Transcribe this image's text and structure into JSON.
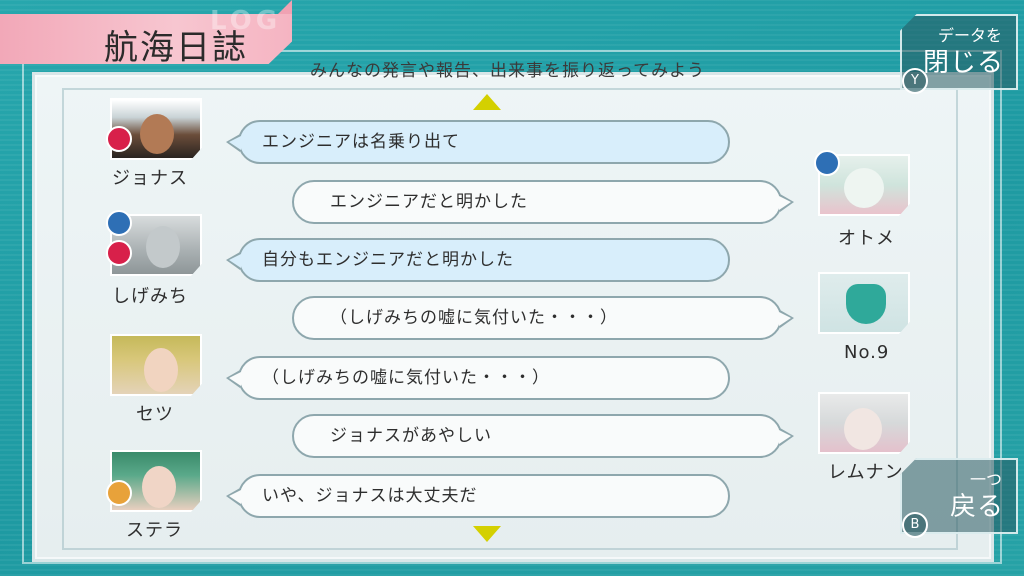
{
  "header": {
    "title": "航海日誌",
    "subtitle": "みんなの発言や報告、出来事を振り返ってみよう",
    "ghost_logo": "LOG"
  },
  "buttons": {
    "close": {
      "line1": "データを",
      "line2": "閉じる",
      "key": "Y"
    },
    "back": {
      "line1": "一つ",
      "line2": "戻る",
      "key": "B"
    }
  },
  "log": [
    {
      "speaker": "ジョナス",
      "side": "left",
      "text": "エンジニアは名乗り出て",
      "style": "blue"
    },
    {
      "speaker": "オトメ",
      "side": "right",
      "text": "エンジニアだと明かした",
      "style": "white"
    },
    {
      "speaker": "しげみち",
      "side": "left",
      "text": "自分もエンジニアだと明かした",
      "style": "blue"
    },
    {
      "speaker": "No.9",
      "side": "right",
      "text": "（しげみちの嘘に気付いた・・・）",
      "style": "white"
    },
    {
      "speaker": "セツ",
      "side": "left",
      "text": "（しげみちの嘘に気付いた・・・）",
      "style": "white"
    },
    {
      "speaker": "レムナン",
      "side": "right",
      "text": "ジョナスがあやしい",
      "style": "white"
    },
    {
      "speaker": "ステラ",
      "side": "left",
      "text": "いや、ジョナスは大丈夫だ",
      "style": "white"
    }
  ],
  "icons": {
    "scroll_up": "triangle-up-icon",
    "scroll_down": "triangle-down-icon"
  },
  "colors": {
    "background": "#1e9aa2",
    "title_tab": "#f5b4c2",
    "bubble_blue": "#d8eefb",
    "bubble_white": "#f9fbfb",
    "arrow": "#d4d000",
    "engineer_icon": "#2e6fb5",
    "enemy_icon": "#d8204a",
    "guardian_icon": "#e8a23a",
    "bug_icon": "#2fa99a"
  }
}
